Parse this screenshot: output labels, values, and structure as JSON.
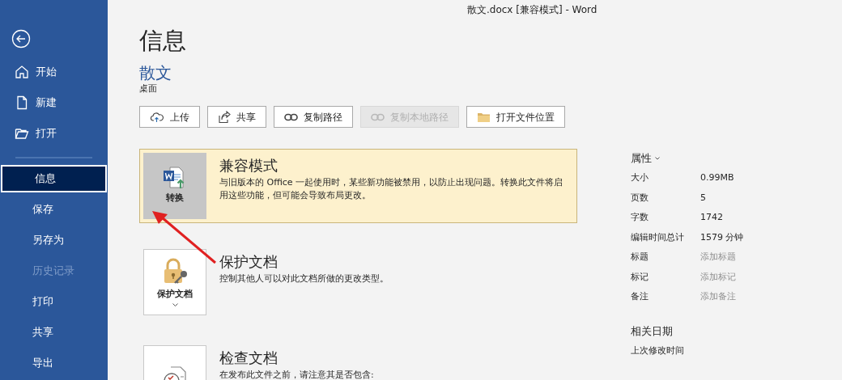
{
  "window": {
    "title": "散文.docx [兼容模式]  -  Word"
  },
  "sidebar": {
    "items": [
      {
        "label": "开始",
        "kind": "home",
        "selected": false,
        "disabled": false
      },
      {
        "label": "新建",
        "kind": "new",
        "selected": false,
        "disabled": false
      },
      {
        "label": "打开",
        "kind": "open",
        "selected": false,
        "disabled": false
      },
      {
        "label": "信息",
        "kind": "plain",
        "selected": true,
        "disabled": false
      },
      {
        "label": "保存",
        "kind": "plain",
        "selected": false,
        "disabled": false
      },
      {
        "label": "另存为",
        "kind": "plain",
        "selected": false,
        "disabled": false
      },
      {
        "label": "历史记录",
        "kind": "plain",
        "selected": false,
        "disabled": true
      },
      {
        "label": "打印",
        "kind": "plain",
        "selected": false,
        "disabled": false
      },
      {
        "label": "共享",
        "kind": "plain",
        "selected": false,
        "disabled": false
      },
      {
        "label": "导出",
        "kind": "plain",
        "selected": false,
        "disabled": false
      }
    ]
  },
  "page": {
    "heading": "信息",
    "document_name": "散文",
    "location": "桌面"
  },
  "actions": [
    {
      "label": "上传",
      "kind": "upload",
      "disabled": false
    },
    {
      "label": "共享",
      "kind": "share",
      "disabled": false
    },
    {
      "label": "复制路径",
      "kind": "link",
      "disabled": false
    },
    {
      "label": "复制本地路径",
      "kind": "link",
      "disabled": true
    },
    {
      "label": "打开文件位置",
      "kind": "folder",
      "disabled": false
    }
  ],
  "sections": [
    {
      "kind": "convert",
      "button": "转换",
      "title": "兼容模式",
      "description": "与旧版本的 Office 一起使用时，某些新功能被禁用，以防止出现问题。转换此文件将启用这些功能，但可能会导致布局更改。",
      "highlighted": true,
      "dropdown": false
    },
    {
      "kind": "protect",
      "button": "保护文档",
      "title": "保护文档",
      "description": "控制其他人可以对此文档所做的更改类型。",
      "highlighted": false,
      "dropdown": true
    },
    {
      "kind": "inspect",
      "title": "检查文档",
      "description": "在发布此文件之前，请注意其是否包含:",
      "highlighted": false,
      "dropdown": false
    }
  ],
  "properties": {
    "heading": "属性",
    "rows": [
      {
        "label": "大小",
        "value": "0.99MB"
      },
      {
        "label": "页数",
        "value": "5"
      },
      {
        "label": "字数",
        "value": "1742"
      },
      {
        "label": "编辑时间总计",
        "value": "1579 分钟"
      },
      {
        "label": "标题",
        "placeholder": "添加标题"
      },
      {
        "label": "标记",
        "placeholder": "添加标记"
      },
      {
        "label": "备注",
        "placeholder": "添加备注"
      }
    ]
  },
  "related_dates": {
    "heading": "相关日期",
    "rows": [
      {
        "label": "上次修改时间"
      }
    ]
  }
}
